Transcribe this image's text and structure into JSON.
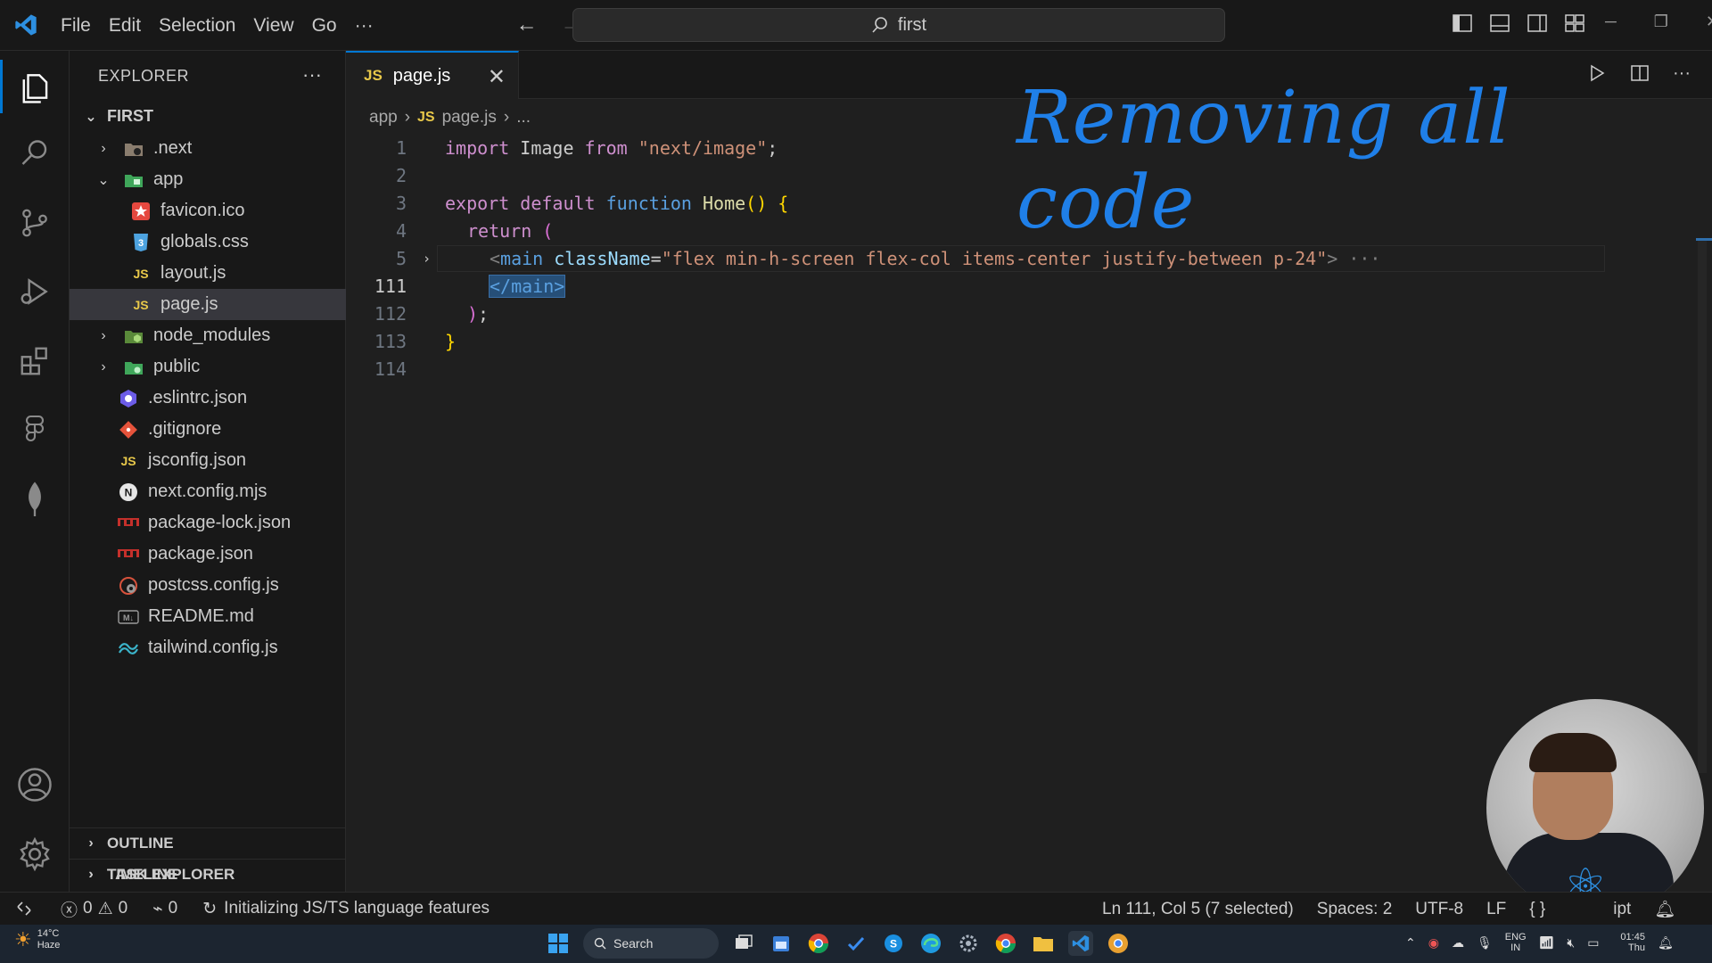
{
  "menu": {
    "items": [
      "File",
      "Edit",
      "Selection",
      "View",
      "Go",
      "···"
    ]
  },
  "command_center": {
    "text": "first"
  },
  "sidebar": {
    "title": "EXPLORER",
    "more": "···",
    "root": "FIRST",
    "items": [
      {
        "label": ".next",
        "type": "folder",
        "expanded": false
      },
      {
        "label": "app",
        "type": "folder",
        "expanded": true
      },
      {
        "label": "favicon.ico",
        "type": "file"
      },
      {
        "label": "globals.css",
        "type": "file"
      },
      {
        "label": "layout.js",
        "type": "file"
      },
      {
        "label": "page.js",
        "type": "file",
        "selected": true
      },
      {
        "label": "node_modules",
        "type": "folder",
        "expanded": false
      },
      {
        "label": "public",
        "type": "folder",
        "expanded": false
      },
      {
        "label": ".eslintrc.json",
        "type": "file"
      },
      {
        "label": ".gitignore",
        "type": "file"
      },
      {
        "label": "jsconfig.json",
        "type": "file"
      },
      {
        "label": "next.config.mjs",
        "type": "file"
      },
      {
        "label": "package-lock.json",
        "type": "file"
      },
      {
        "label": "package.json",
        "type": "file"
      },
      {
        "label": "postcss.config.js",
        "type": "file"
      },
      {
        "label": "README.md",
        "type": "file"
      },
      {
        "label": "tailwind.config.js",
        "type": "file"
      }
    ],
    "sections": [
      "OUTLINE",
      "TIMELINE",
      "TASK EXPLORER"
    ]
  },
  "editor": {
    "tab": {
      "badge": "JS",
      "label": "page.js",
      "close": "✕"
    },
    "breadcrumb": [
      "app",
      "JS",
      "page.js",
      "..."
    ],
    "line_numbers": [
      "1",
      "2",
      "3",
      "4",
      "5",
      "111",
      "112",
      "113",
      "114"
    ],
    "code": {
      "l1": {
        "kw": "import",
        "id": " Image ",
        "kw2": "from",
        "str": " \"next/image\"",
        "end": ";"
      },
      "l3": {
        "kw": "export default",
        "kw2": " function ",
        "fn": "Home",
        "paren": "()",
        "brace": " {"
      },
      "l4": {
        "kw": "return",
        "paren": " ("
      },
      "l5": {
        "open": "<",
        "tag": "main",
        "attr": " className",
        "eq": "=",
        "str": "\"flex min-h-screen flex-col items-center justify-between p-24\"",
        "close": ">",
        "ellipsis": "···"
      },
      "l111": {
        "text": "</main>"
      },
      "l112": {
        "paren": ")",
        "end": ";"
      },
      "l113": {
        "brace": "}"
      }
    },
    "annotation": "Removing all code"
  },
  "statusbar": {
    "errors": "0",
    "warnings": "0",
    "ports": "0",
    "message": "Initializing JS/TS language features",
    "position": "Ln 111, Col 5 (7 selected)",
    "spaces": "Spaces: 2",
    "encoding": "UTF-8",
    "eol": "LF",
    "language_icon": "{ }",
    "language_partial": "ipt"
  },
  "taskbar": {
    "weather_temp": "14°C",
    "weather_desc": "Haze",
    "search": "Search",
    "lang": "ENG",
    "region": "IN",
    "time": "01:45",
    "day": "Thu"
  },
  "colors": {
    "accent": "#0078d4",
    "annotation": "#1f7fe8",
    "js_badge": "#e8c84a"
  }
}
